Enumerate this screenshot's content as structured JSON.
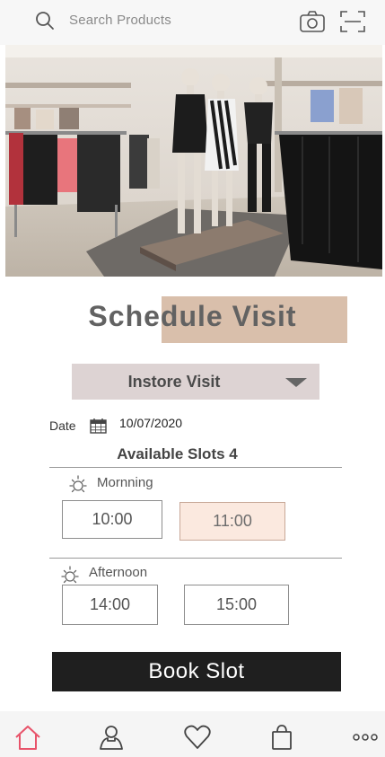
{
  "header": {
    "search_placeholder": "Search Products",
    "icons": [
      "search-icon",
      "camera-icon",
      "scan-icon"
    ]
  },
  "hero": {
    "image": "store-interior-photo"
  },
  "page": {
    "title": "Schedule Visit",
    "highlight_color": "#d9bfab"
  },
  "visit_type": {
    "selected": "Instore Visit"
  },
  "date": {
    "label": "Date",
    "value": "10/07/2020"
  },
  "slots": {
    "available_label": "Available Slots 4",
    "morning": {
      "label": "Mornning",
      "times": [
        "10:00",
        "11:00"
      ],
      "selected": "11:00"
    },
    "afternoon": {
      "label": "Afternoon",
      "times": [
        "14:00",
        "15:00"
      ]
    }
  },
  "actions": {
    "book_label": "Book Slot"
  },
  "bottom_nav": {
    "items": [
      "home-icon",
      "profile-icon",
      "wishlist-icon",
      "bag-icon",
      "more-icon"
    ],
    "active": "home-icon",
    "active_color": "#e8536a"
  }
}
